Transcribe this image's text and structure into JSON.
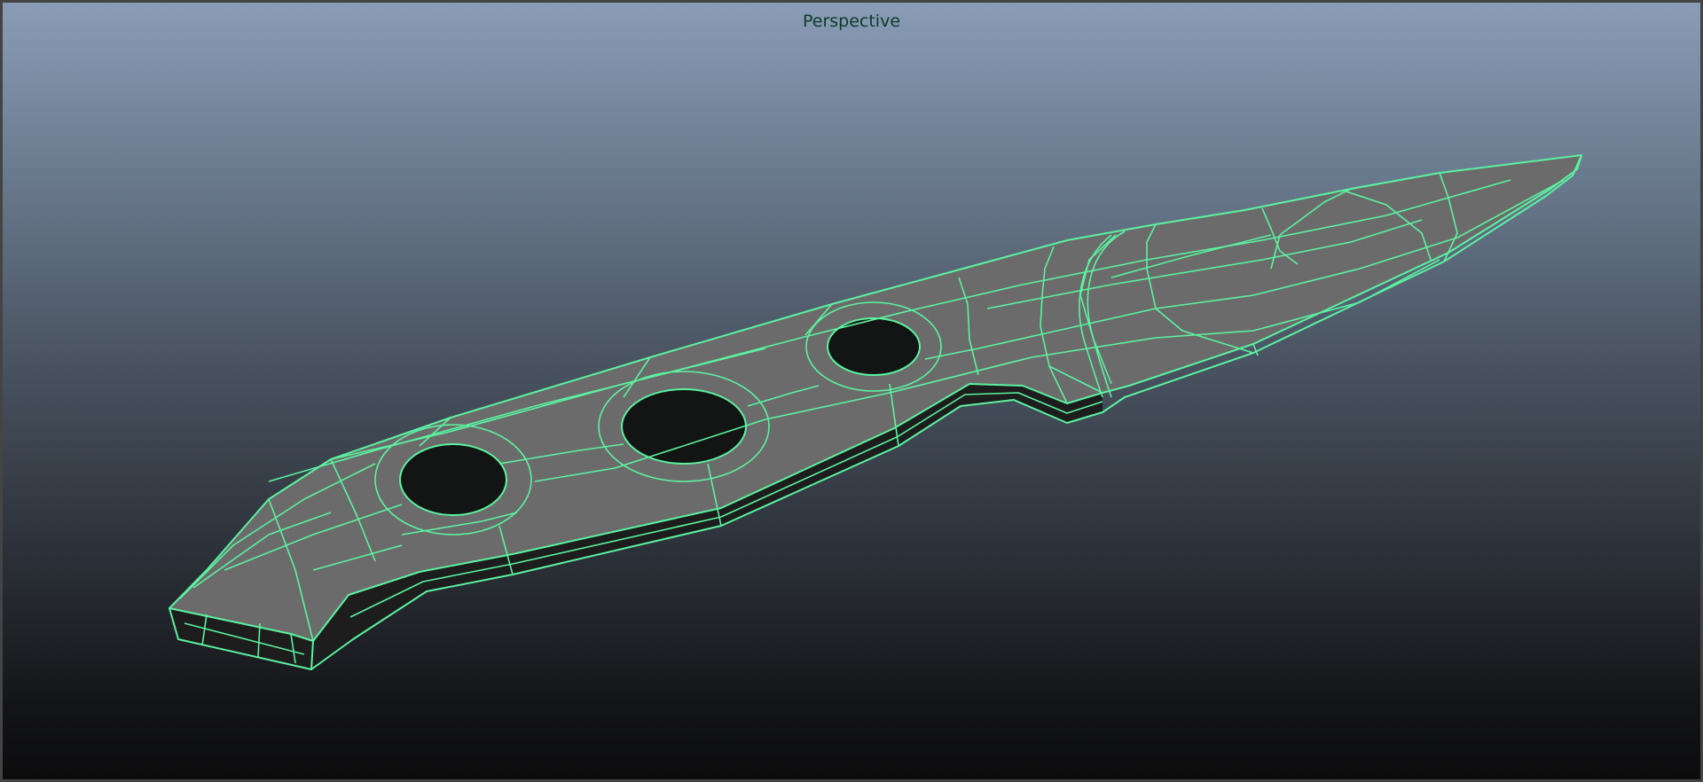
{
  "viewport": {
    "label": "Perspective"
  },
  "scene": {
    "object": "knife-mesh",
    "display": "wireframe-on-shaded",
    "colors": {
      "wireframe": "#5cf2a0",
      "surface": "#6b6b6b",
      "side": "#1c1d1c",
      "hole_inner": "#121513",
      "bg_top": "#8a9cb6",
      "bg_bottom": "#0c0c0d",
      "label": "#0d3b26"
    }
  }
}
